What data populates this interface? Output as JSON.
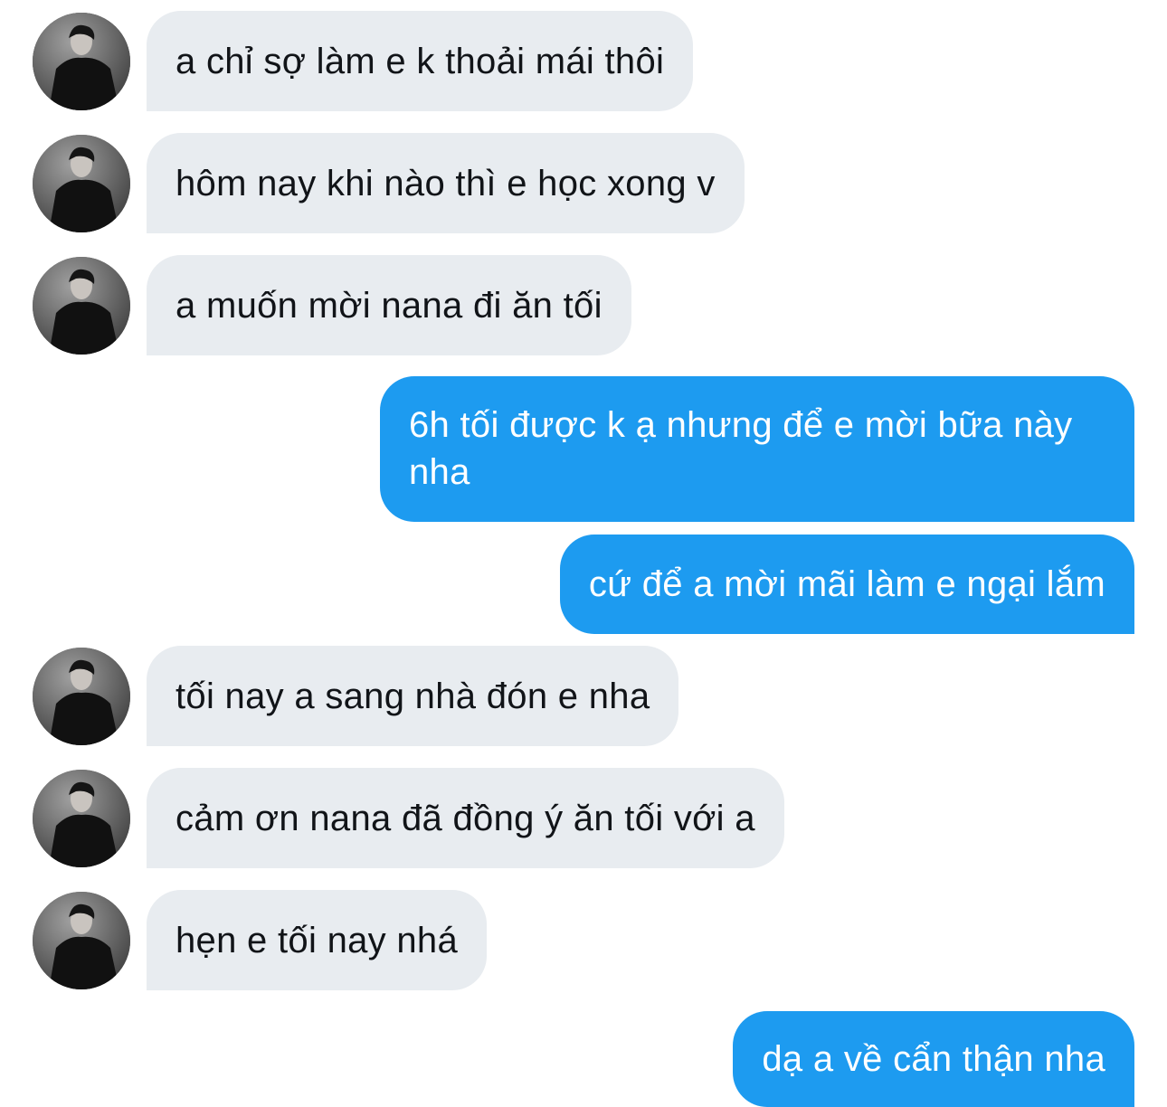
{
  "messages": [
    {
      "from": "them",
      "text": "a chỉ sợ làm e k thoải mái thôi"
    },
    {
      "from": "them",
      "text": "hôm nay khi nào thì e học xong v"
    },
    {
      "from": "them",
      "text": "a muốn mời nana đi ăn tối"
    },
    {
      "from": "me",
      "text": "6h tối được k ạ nhưng để e mời bữa này nha"
    },
    {
      "from": "me",
      "text": "cứ để a mời mãi làm e ngại lắm"
    },
    {
      "from": "them",
      "text": "tối nay a sang nhà đón e nha"
    },
    {
      "from": "them",
      "text": "cảm ơn nana đã đồng ý ăn tối với a"
    },
    {
      "from": "them",
      "text": "hẹn e tối nay nhá"
    },
    {
      "from": "me",
      "text": "dạ a về cẩn thận nha"
    }
  ],
  "colors": {
    "incoming_bubble": "#e8ecf0",
    "incoming_text": "#111418",
    "outgoing_bubble": "#1d9bf0",
    "outgoing_text": "#ffffff"
  },
  "icons": {
    "avatar": "contact-avatar-photo"
  }
}
